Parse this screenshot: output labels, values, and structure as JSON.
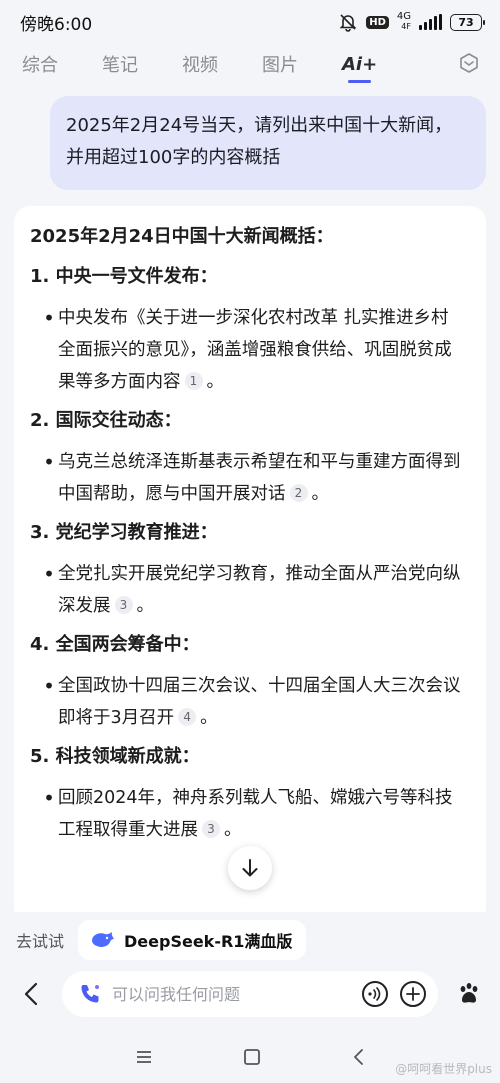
{
  "status": {
    "time": "傍晚6:00",
    "network": "4G",
    "network_sub": "4F",
    "hd": "HD",
    "battery": "73"
  },
  "tabs": [
    {
      "label": "综合",
      "active": false
    },
    {
      "label": "笔记",
      "active": false
    },
    {
      "label": "视频",
      "active": false
    },
    {
      "label": "图片",
      "active": false
    },
    {
      "label": "Ai+",
      "active": true
    }
  ],
  "query": "2025年2月24号当天，请列出来中国十大新闻，并用超过100字的内容概括",
  "answer": {
    "title": "2025年2月24日中国十大新闻概括：",
    "sections": [
      {
        "heading": "1. 中央一号文件发布：",
        "text": "中央发布《关于进一步深化农村改革 扎实推进乡村全面振兴的意见》，涵盖增强粮食供给、巩固脱贫成果等多方面内容",
        "cite": "1",
        "end": "。"
      },
      {
        "heading": "2. 国际交往动态：",
        "text": "乌克兰总统泽连斯基表示希望在和平与重建方面得到中国帮助，愿与中国开展对话",
        "cite": "2",
        "end": "。"
      },
      {
        "heading": "3. 党纪学习教育推进：",
        "text": "全党扎实开展党纪学习教育，推动全面从严治党向纵深发展",
        "cite": "3",
        "end": "。"
      },
      {
        "heading": "4. 全国两会筹备中：",
        "text": "全国政协十四届三次会议、十四届全国人大三次会议即将于3月召开",
        "cite": "4",
        "end": "。"
      },
      {
        "heading": "5. 科技领域新成就：",
        "text": "回顾2024年，神舟系列载人飞船、嫦娥六号等科技工程取得重大进展",
        "cite": "3",
        "end": "。"
      }
    ]
  },
  "try": {
    "label": "去试试",
    "chip": "DeepSeek-R1满血版"
  },
  "input": {
    "placeholder": "可以问我任何问题"
  },
  "watermark": "@呵呵看世界plus",
  "colors": {
    "accent": "#4c5cf5",
    "bubble": "#e3e5fb",
    "background": "#f4f5f9"
  }
}
